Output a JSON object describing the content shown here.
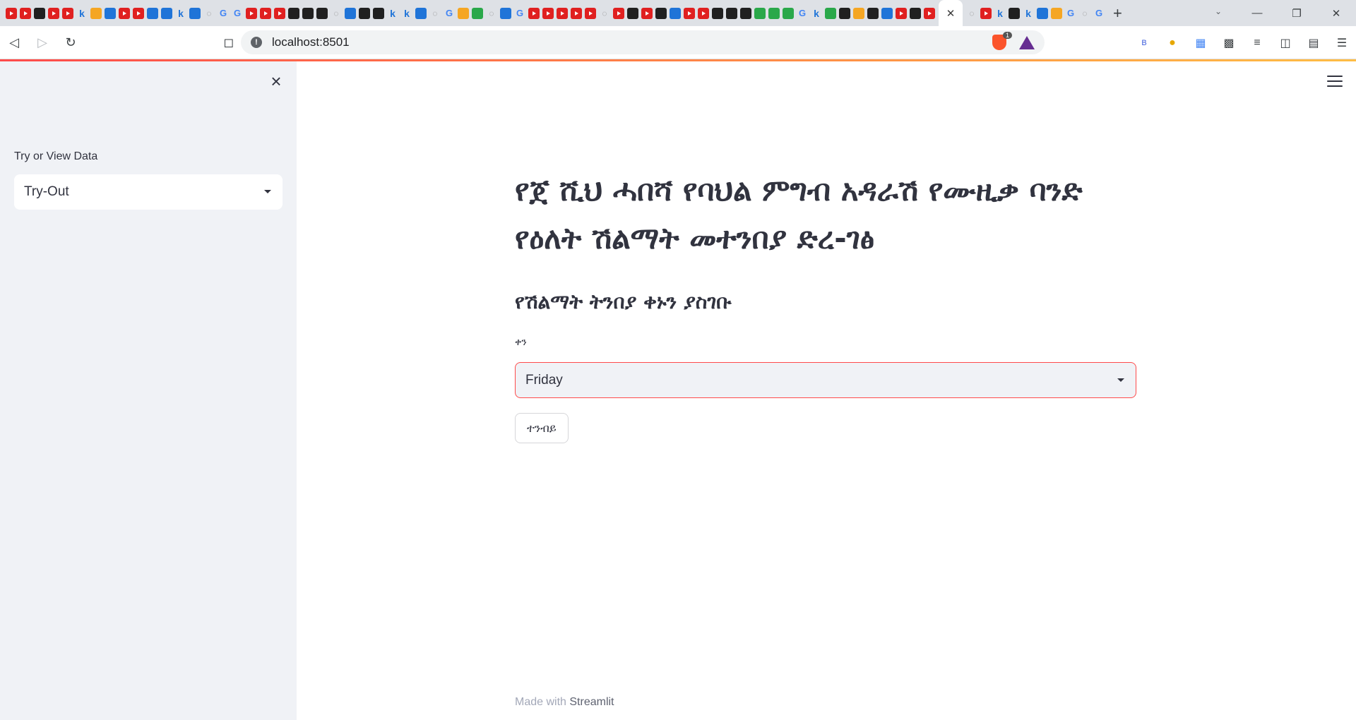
{
  "browser": {
    "tab_favicons": [
      "yt",
      "yt",
      "d",
      "yt",
      "yt",
      "k",
      "s",
      "b",
      "yt",
      "yt",
      "b",
      "b",
      "k",
      "b",
      "o",
      "g",
      "g",
      "yt",
      "yt",
      "yt",
      "d",
      "d",
      "d",
      "o",
      "b",
      "d",
      "d",
      "k",
      "k",
      "b",
      "o",
      "g",
      "s",
      "gr",
      "o",
      "b",
      "g",
      "yt",
      "yt",
      "yt",
      "yt",
      "yt",
      "o",
      "yt",
      "d",
      "yt",
      "d",
      "b",
      "yt",
      "yt",
      "d",
      "d",
      "d",
      "gr",
      "gr",
      "gr",
      "g",
      "k",
      "gr",
      "d",
      "s",
      "d",
      "b",
      "yt",
      "d",
      "yt",
      "o",
      "yt",
      "k",
      "d",
      "k",
      "b",
      "s",
      "g",
      "o",
      "g"
    ],
    "active_tab_close_icon": "✕",
    "new_tab_icon": "+",
    "url": "localhost:8501",
    "brave_shield_count": "1"
  },
  "sidebar": {
    "label": "Try or View Data",
    "selected": "Try-Out"
  },
  "main": {
    "title": "የጀ ሺህ ሓበሻ የባህል ምግብ አዳራሽ የሙዚቃ ባንድ የዕለት ሽልማት መተንበያ ድረ-ገፅ",
    "subheader": "የሽልማት ትንበያ ቀኑን ያስገቡ",
    "day_label": "ቀን",
    "day_selected": "Friday",
    "predict_button": "ተንብይ"
  },
  "footer": {
    "prefix": "Made with",
    "brand": "Streamlit"
  },
  "colors": {
    "accent": "#ff4b4b",
    "sidebar_bg": "#f0f2f6",
    "text": "#31333f"
  }
}
